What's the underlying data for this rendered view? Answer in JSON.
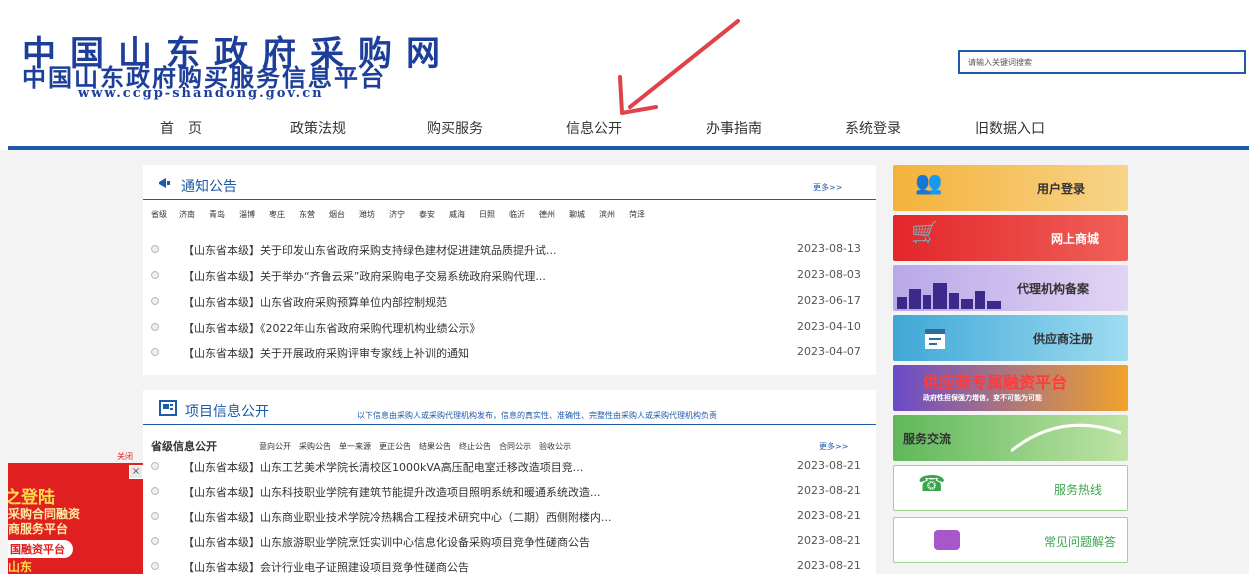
{
  "header": {
    "logo_line1": "中国山东政府采购网",
    "logo_line2": "中国山东政府购买服务信息平台",
    "logo_url": "www.ccgp-shandong.gov.cn",
    "search_placeholder": "请输入关键词搜索"
  },
  "nav": [
    "首　页",
    "政策法规",
    "购买服务",
    "信息公开",
    "办事指南",
    "系统登录",
    "旧数据入口"
  ],
  "notice": {
    "title": "通知公告",
    "more": "更多>>",
    "cities": [
      "省级",
      "济南",
      "青岛",
      "淄博",
      "枣庄",
      "东营",
      "烟台",
      "潍坊",
      "济宁",
      "泰安",
      "威海",
      "日照",
      "临沂",
      "德州",
      "聊城",
      "滨州",
      "菏泽"
    ],
    "items": [
      {
        "title": "【山东省本级】关于印发山东省政府采购支持绿色建材促进建筑品质提升试...",
        "date": "2023-08-13"
      },
      {
        "title": "【山东省本级】关于举办“齐鲁云采”政府采购电子交易系统政府采购代理...",
        "date": "2023-08-03"
      },
      {
        "title": "【山东省本级】山东省政府采购预算单位内部控制规范",
        "date": "2023-06-17"
      },
      {
        "title": "【山东省本级】《2022年山东省政府采购代理机构业绩公示》",
        "date": "2023-04-10"
      },
      {
        "title": "【山东省本级】关于开展政府采购评审专家线上补训的通知",
        "date": "2023-04-07"
      }
    ]
  },
  "project": {
    "title": "项目信息公开",
    "note": "以下信息由采购人或采购代理机构发布，信息的真实性、准确性、完整性由采购人或采购代理机构负责",
    "level": "省级信息公开",
    "tabs": [
      "意向公开",
      "采购公告",
      "单一来源",
      "更正公告",
      "结果公告",
      "终止公告",
      "合同公示",
      "验收公示"
    ],
    "more": "更多>>",
    "items": [
      {
        "title": "【山东省本级】山东工艺美术学院长清校区1000kVA高压配电室迁移改造项目竞...",
        "date": "2023-08-21"
      },
      {
        "title": "【山东省本级】山东科技职业学院有建筑节能提升改造项目照明系统和暖通系统改造...",
        "date": "2023-08-21"
      },
      {
        "title": "【山东省本级】山东商业职业技术学院冷热耦合工程技术研究中心（二期）西侧附楼内...",
        "date": "2023-08-21"
      },
      {
        "title": "【山东省本级】山东旅游职业学院烹饪实训中心信息化设备采购项目竞争性磋商公告",
        "date": "2023-08-21"
      },
      {
        "title": "【山东省本级】会计行业电子证照建设项目竞争性磋商公告",
        "date": "2023-08-21"
      }
    ]
  },
  "side": [
    {
      "label": "用户登录",
      "icon": "users-icon"
    },
    {
      "label": "网上商城",
      "icon": "cart-icon"
    },
    {
      "label": "代理机构备案",
      "icon": "city-icon"
    },
    {
      "label": "供应商注册",
      "icon": "register-icon"
    },
    {
      "label": "供应商专属融资平台",
      "sub": "政府性担保强力增信，变不可能为可能",
      "icon": "finance-icon"
    },
    {
      "label": "服务交流",
      "icon": "leaf-icon"
    },
    {
      "label": "服务热线",
      "icon": "phone-icon"
    },
    {
      "label": "常见问题解答",
      "icon": "chat-icon"
    }
  ],
  "ad": {
    "close_label": "关闭",
    "close_x": "×",
    "line1": "之登陆",
    "line2": "采购合同融资",
    "line3": "商服务平台",
    "line4": "国融资平台",
    "line5": "山东"
  },
  "colors": {
    "brand_blue": "#1d5aa8",
    "logo_blue": "#1d3f9a",
    "ad_red": "#e02020",
    "arrow_red": "#e0424a"
  }
}
